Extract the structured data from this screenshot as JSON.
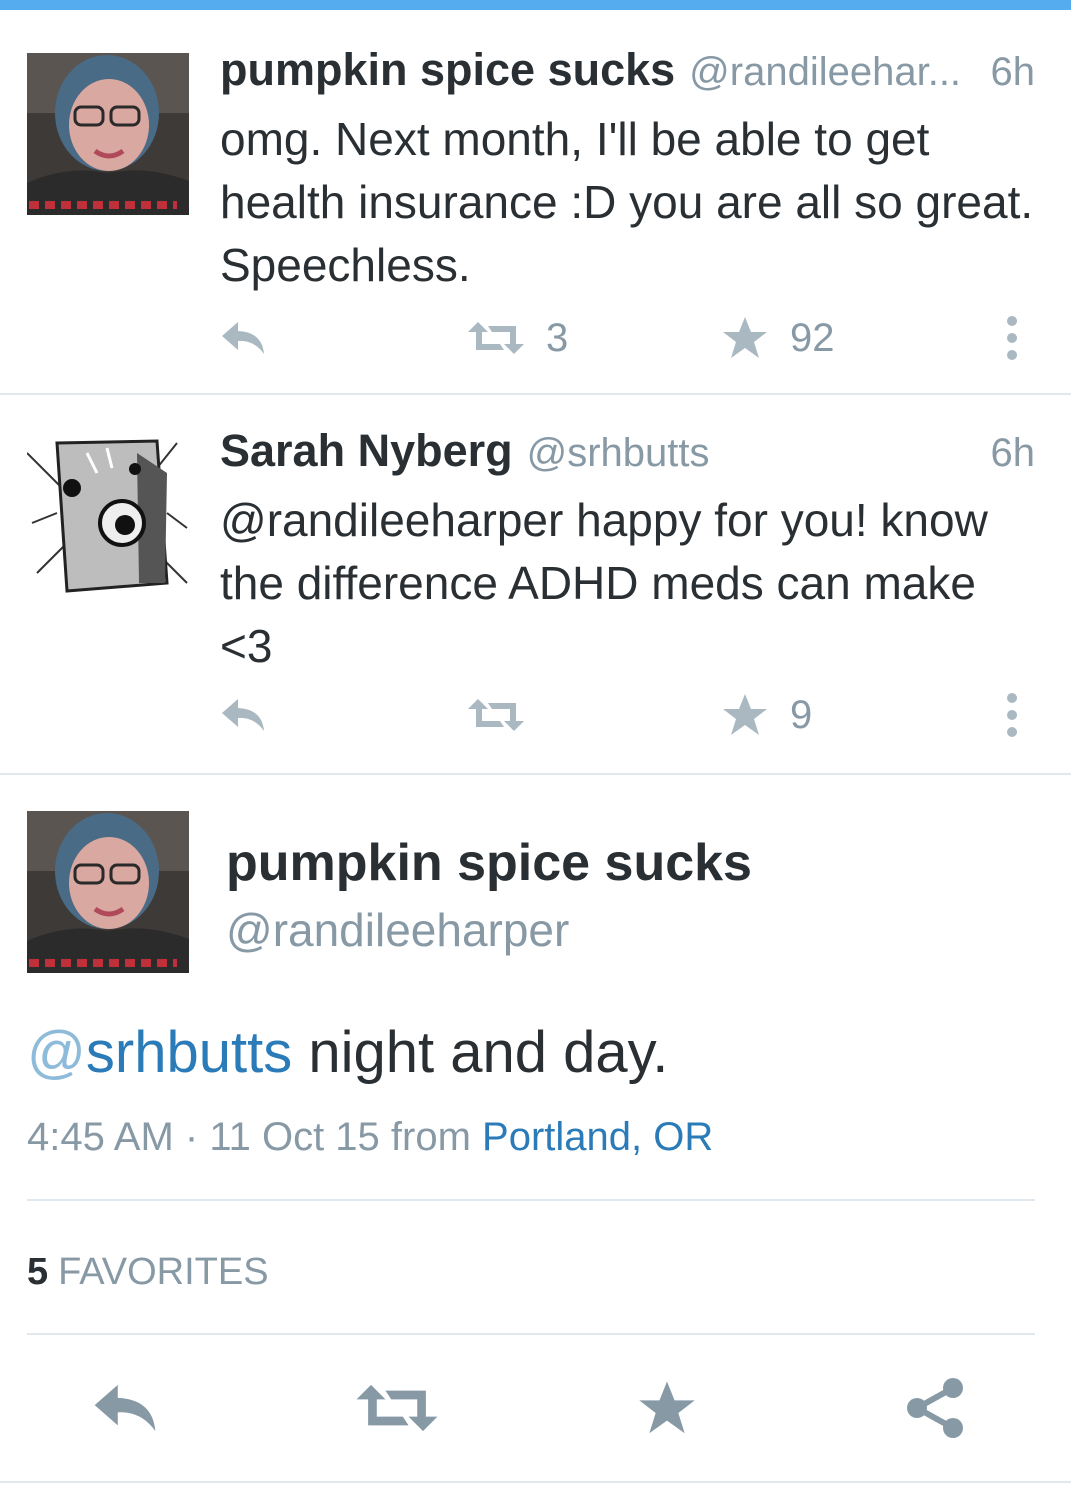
{
  "colors": {
    "accent": "#55acee",
    "link": "#2b7bb9",
    "text": "#292f33",
    "muted": "#8899a6",
    "icon": "#aab8c2",
    "divider": "#e1e8ed"
  },
  "timeline": [
    {
      "name": "pumpkin spice sucks",
      "handle": "@randileehar...",
      "time": "6h",
      "text": "omg. Next month, I'll be able to get health insurance :D you are all so great. Speechless.",
      "retweets": "3",
      "favorites": "92",
      "avatar_icon": "user-photo-avatar"
    },
    {
      "name": "Sarah Nyberg",
      "handle": "@srhbutts",
      "time": "6h",
      "text": "@randileeharper happy for you! know the difference ADHD meds can make <3",
      "retweets": "",
      "favorites": "9",
      "avatar_icon": "illustrated-avatar"
    }
  ],
  "detail": {
    "name": "pumpkin spice sucks",
    "handle": "@randileeharper",
    "mention_at": "@",
    "mention": "srhbutts",
    "text": " night and day.",
    "time": "4:45 AM",
    "date": " · 11 Oct 15 ",
    "from": "from ",
    "location": "Portland, OR",
    "favorites_count": "5",
    "favorites_label": "FAVORITES"
  },
  "icons": {
    "reply": "reply-icon",
    "retweet": "retweet-icon",
    "favorite": "star-icon",
    "more": "more-vertical-icon",
    "share": "share-icon"
  }
}
